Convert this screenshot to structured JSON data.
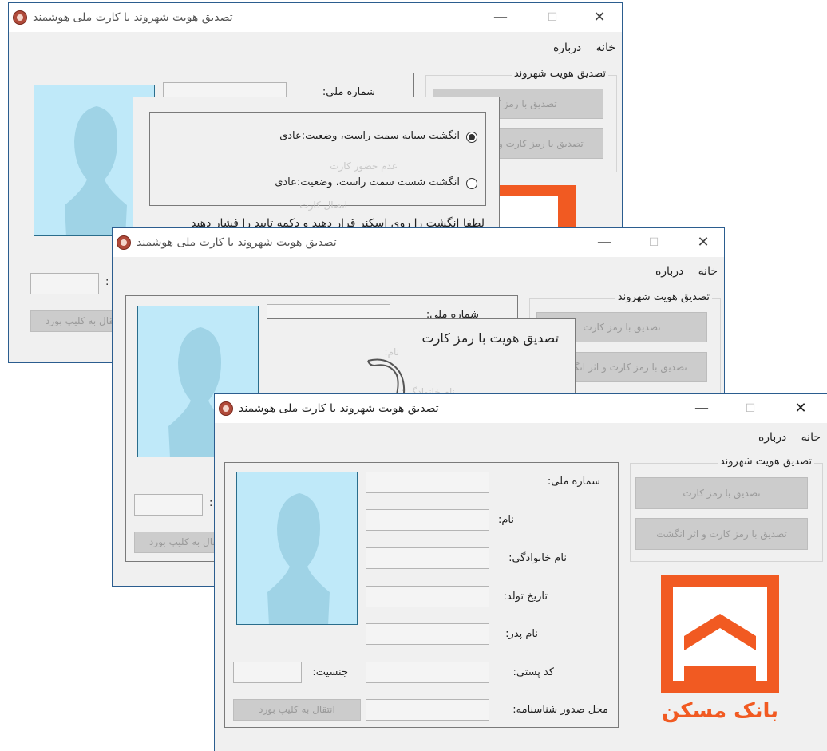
{
  "window_title": "تصدیق هویت شهروند با کارت ملی هوشمند",
  "menu": {
    "home": "خانه",
    "about": "درباره"
  },
  "controls": {
    "minimize": "—",
    "maximize": "☐",
    "close": "✕"
  },
  "verify_group": {
    "title": "تصدیق هویت شهروند",
    "btn_pin": "تصدیق با رمز کارت",
    "btn_pin_finger": "تصدیق با رمز کارت و اثر انگشت"
  },
  "form": {
    "national_id": "شماره ملی:",
    "first_name": "نام:",
    "last_name": "نام خانوادگی:",
    "birth_date": "تاریخ تولد:",
    "father_name": "نام پدر:",
    "postal_code": "کد پستی:",
    "issue_place": "محل صدور شناسنامه:",
    "gender": "جنسیت:",
    "clipboard_btn": "انتقال به کلیپ بورد"
  },
  "finger_dialog": {
    "option1": "انگشت سبابه سمت راست، وضعیت:عادی",
    "option2": "انگشت شست سمت راست، وضعیت:عادی",
    "instruction": "لطفا انگشت را روی اسکنر قرار دهید و دکمه تایید را فشار دهید",
    "ghost1": "عدم حضور کارت",
    "ghost2": "اتصال کارت"
  },
  "pin_dialog": {
    "title": "تصدیق هویت با رمز کارت",
    "ghost1": "نام:",
    "ghost2": "نام خانوادگی:"
  },
  "logo": {
    "text": "بانک مسکن",
    "color": "#f15a22"
  },
  "colors": {
    "accent_orange": "#f15a22",
    "photo_bg": "#bfe9f9",
    "silhouette": "#9fd3e6"
  }
}
